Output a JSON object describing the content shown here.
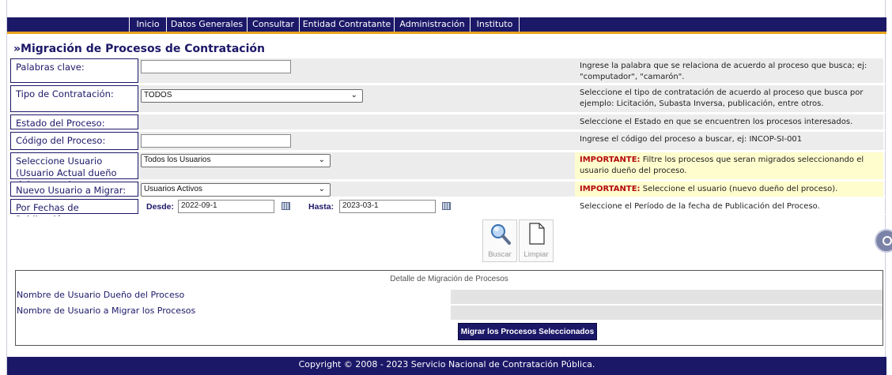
{
  "nav": {
    "items": [
      "Inicio",
      "Datos Generales",
      "Consultar",
      "Entidad Contratante",
      "Administración",
      "Instituto"
    ]
  },
  "page_title": "»Migración de Procesos de Contratación",
  "form": {
    "palabras": {
      "label": "Palabras clave:",
      "value": "",
      "help": "Ingrese la palabra que se relaciona de acuerdo al proceso que busca; ej: \"computador\", \"camarón\"."
    },
    "tipo": {
      "label": "Tipo de Contratación:",
      "selected": "TODOS",
      "help": "Seleccione el tipo de contratación de acuerdo al proceso que busca por ejemplo: Licitación, Subasta Inversa, publicación, entre otros."
    },
    "estado": {
      "label": "Estado del Proceso:",
      "help": "Seleccione el Estado en que se encuentren los procesos interesados."
    },
    "codigo": {
      "label": "Código del Proceso:",
      "value": "",
      "help": "Ingrese el código del proceso a buscar, ej: INCOP-SI-001"
    },
    "usuario_actual": {
      "label": "Seleccione Usuario (Usuario Actual dueño del proceso):",
      "selected": "Todos los Usuarios",
      "help_strong": "IMPORTANTE:",
      "help": " Filtre los procesos que seran migrados seleccionando el usuario dueño del proceso."
    },
    "nuevo_usuario": {
      "label": "Nuevo Usuario a Migrar:",
      "selected": "Usuarios Activos",
      "help_strong": "IMPORTANTE:",
      "help": " Seleccione el usuario (nuevo dueño del proceso)."
    },
    "fechas": {
      "label": "Por Fechas de Publicación",
      "desde_label": "Desde:",
      "desde_value": "2022-09-1",
      "hasta_label": "Hasta:",
      "hasta_value": "2023-03-1",
      "help": "Seleccione el Período de la fecha de Publicación del Proceso."
    }
  },
  "buttons": {
    "buscar": "Buscar",
    "limpiar": "Limpiar"
  },
  "detail": {
    "title": "Detalle de Migración de Procesos",
    "owner_label": "Nombre de Usuario Dueño del Proceso",
    "target_label": "Nombre de Usuario a Migrar los Procesos",
    "owner_value": "",
    "target_value": "",
    "migrar_button": "Migrar los Procesos Seleccionados"
  },
  "footer": "Copyright © 2008 - 2023 Servicio Nacional de Contratación Pública.",
  "colors": {
    "primary": "#1c1868",
    "accent": "#e9a21b",
    "warning_bg": "#fffccd",
    "warning_text": "#b20a0a"
  },
  "icons": {
    "buscar": "magnifier-icon",
    "limpiar": "blank-page-icon",
    "calendar": "calendar-icon"
  }
}
